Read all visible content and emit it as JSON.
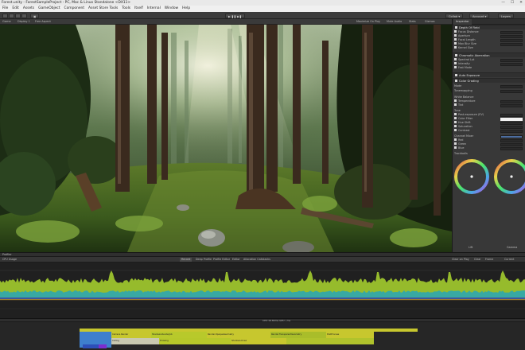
{
  "window": {
    "title": "Forest.unity - ForestSampleProject - PC, Mac & Linux Standalone <DX11>",
    "minimize_glyph": "—",
    "maximize_glyph": "☐",
    "close_glyph": "✕"
  },
  "menu": [
    "File",
    "Edit",
    "Assets",
    "GameObject",
    "Component",
    "Asset Store Tools",
    "Tools",
    "Itself",
    "Internal",
    "Window",
    "Help"
  ],
  "toolbar": {
    "center_label": "▶  ❚❚  ▶❚",
    "collab_label": "Collab ▾",
    "account_label": "Account ▾",
    "layers_label": "Layers",
    "layout_label": "Layout ▾"
  },
  "game_view": {
    "tab_label": "Game",
    "display_label": "Display 1",
    "aspect_label": "Free Aspect",
    "maximize_label": "Maximize On Play",
    "mute_label": "Mute Audio",
    "stats_label": "Stats",
    "gizmos_label": "Gizmos"
  },
  "inspector": {
    "tab_label": "Inspector",
    "sections": {
      "dof": "Depth Of Field",
      "chromatic": "Chromatic Aberration",
      "auto_exposure": "Auto Exposure",
      "color_grading": "Color Grading"
    },
    "dof_rows": [
      "Focus Distance",
      "Aperture",
      "Focal Length",
      "Max Blur Size",
      "Kernel Size"
    ],
    "chromatic_rows": [
      "Spectral Lut",
      "Intensity",
      "Fast Mode"
    ],
    "grading_rows": [
      "Mode",
      "Tonemapping",
      "White Balance",
      "Temperature",
      "Tint",
      "Tone",
      "Post-exposure (EV)",
      "Color Filter",
      "Hue Shift",
      "Saturation",
      "Contrast",
      "Channel Mixer",
      "Red",
      "Green",
      "Blue",
      "Trackballs"
    ],
    "lift_label": "Lift",
    "gamma_label": "Gamma"
  },
  "profiler": {
    "tab_label": "Profiler",
    "tabs": [
      "Record",
      "Deep Profile",
      "Profile Editor",
      "Editor",
      "Allocation Callstacks",
      "Clear on Play",
      "Clear",
      "Frame",
      "Current"
    ],
    "cpu_label": "CPU Usage",
    "frame_label": "CPU:16.80ms  GPU:--ms",
    "markers": [
      "Camera.Render",
      "Shadows.RenderJob",
      "Render.OpaqueGeometry",
      "Render.TransparentGeometry",
      "PostProcess",
      "Culling",
      "Drawing",
      "Shadows.Draw"
    ]
  },
  "colors": {
    "accent": "#3d7bd8",
    "graph_lime": "#a3cc2e",
    "graph_teal": "#2da7b0",
    "timeline_yellow": "#c7c72e",
    "timeline_blue": "#3e7fcd"
  }
}
